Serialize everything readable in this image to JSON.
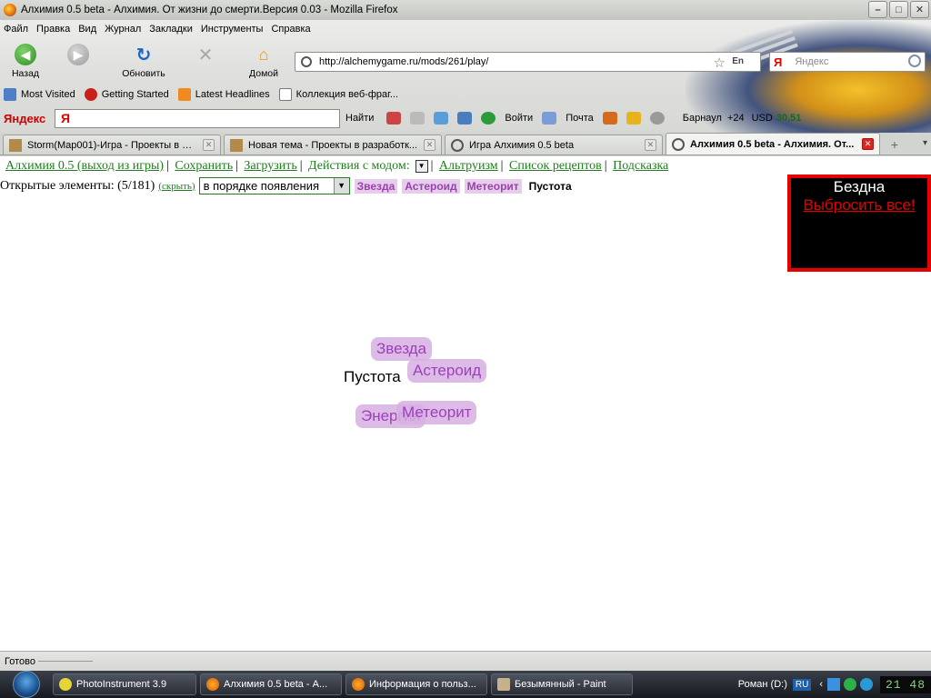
{
  "window": {
    "title": "Алхимия 0.5 beta - Алхимия. От жизни до смерти.Версия 0.03 - Mozilla Firefox"
  },
  "menu": [
    "Файл",
    "Правка",
    "Вид",
    "Журнал",
    "Закладки",
    "Инструменты",
    "Справка"
  ],
  "nav": {
    "back": "Назад",
    "reload": "Обновить",
    "home": "Домой",
    "url": "http://alchemygame.ru/mods/261/play/",
    "search_placeholder": "Яндекс",
    "lang_badge": "En"
  },
  "bookmarks": [
    "Most Visited",
    "Getting Started",
    "Latest Headlines",
    "Коллекция веб-фраг..."
  ],
  "yandex_bar": {
    "logo": "Яндекс",
    "find": "Найти",
    "login": "Войти",
    "mail": "Почта",
    "city": "Барнаул",
    "temp": "+24",
    "usd_label": "USD",
    "usd_value": "30,51"
  },
  "tabs": [
    {
      "label": "Storm(Map001)-Игра - Проекты в ра...",
      "active": false
    },
    {
      "label": "Новая тема - Проекты в разработк...",
      "active": false
    },
    {
      "label": "Игра Алхимия 0.5 beta",
      "active": false
    },
    {
      "label": "Алхимия 0.5 beta - Алхимия. От...",
      "active": true
    }
  ],
  "game": {
    "nav": {
      "exit": "Алхимия 0.5 (выход из игры)",
      "save": "Сохранить",
      "load": "Загрузить",
      "mod_actions": "Действия с модом:",
      "altruism": "Альтруизм",
      "recipes": "Список рецептов",
      "hint": "Подсказка"
    },
    "open_label": "Открытые элементы: (5/181)",
    "hide": "(скрыть)",
    "sort": "в порядке появления",
    "chips": [
      "Звезда",
      "Астероид",
      "Метеорит"
    ],
    "chip_plain": "Пустота",
    "abyss_title": "Бездна",
    "abyss_action": "Выбросить все!",
    "board": {
      "zvezda": "Звезда",
      "pustota": "Пустота",
      "asteroid": "Астероид",
      "energiya": "Энергия",
      "meteorit": "Метеорит"
    }
  },
  "status": "Готово",
  "taskbar": {
    "items": [
      "PhotoInstrument 3.9",
      "Алхимия 0.5 beta - А...",
      "Информация о польз...",
      "Безымянный - Paint"
    ],
    "drive": "Роман (D:)",
    "lang": "RU",
    "clock": "21 48"
  },
  "colors": {
    "link_green": "#1c7f1c",
    "element_purple": "#9e3fba",
    "abyss_border": "#e60000"
  }
}
